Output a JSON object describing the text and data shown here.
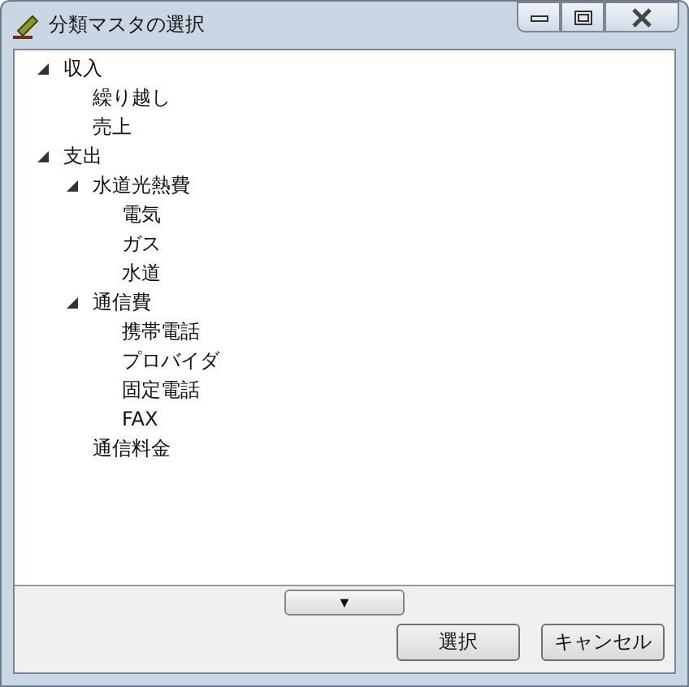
{
  "window": {
    "title": "分類マスタの選択"
  },
  "tree": [
    {
      "label": "収入",
      "expanded": true,
      "children": [
        {
          "label": "繰り越し"
        },
        {
          "label": "売上"
        }
      ]
    },
    {
      "label": "支出",
      "expanded": true,
      "children": [
        {
          "label": "水道光熱費",
          "expanded": true,
          "children": [
            {
              "label": "電気"
            },
            {
              "label": "ガス"
            },
            {
              "label": "水道"
            }
          ]
        },
        {
          "label": "通信費",
          "expanded": true,
          "children": [
            {
              "label": "携帯電話"
            },
            {
              "label": "プロバイダ"
            },
            {
              "label": "固定電話"
            },
            {
              "label": "FAX"
            }
          ]
        },
        {
          "label": "通信料金"
        }
      ]
    }
  ],
  "expand_button": "▼",
  "buttons": [
    {
      "label": "選択"
    },
    {
      "label": "キャンセル"
    }
  ]
}
